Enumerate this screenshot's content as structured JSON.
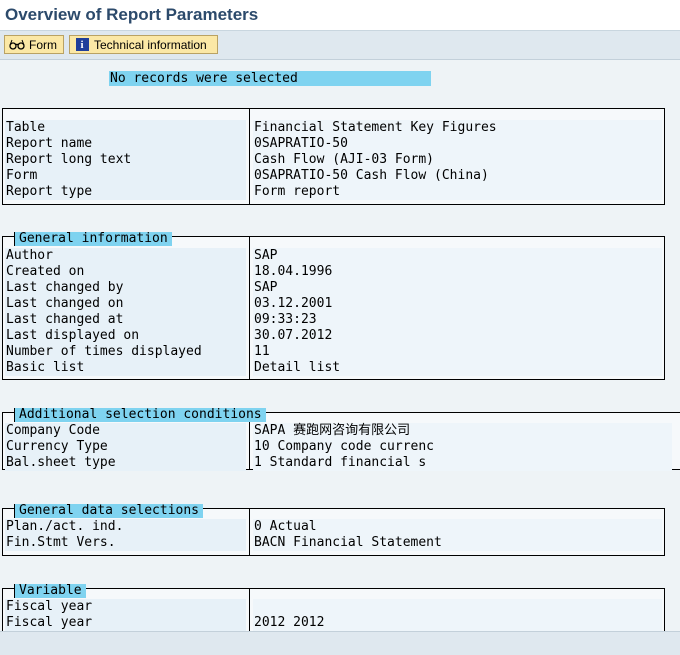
{
  "header": {
    "title": "Overview of Report Parameters"
  },
  "toolbar": {
    "form_label": "Form",
    "tech_label": "Technical information"
  },
  "message": "No records were selected",
  "section1": {
    "rows": [
      {
        "label": "Table",
        "value": "Financial Statement Key Figures"
      },
      {
        "label": "Report name",
        "value": "0SAPRATIO-50"
      },
      {
        "label": "Report long text",
        "value": "Cash Flow (AJI-03 Form)"
      },
      {
        "label": "Form",
        "value": "0SAPRATIO-50 Cash Flow  (China)"
      },
      {
        "label": "Report type",
        "value": "Form report"
      }
    ]
  },
  "general_info": {
    "title": "General information",
    "rows": [
      {
        "label": "Author",
        "value": "SAP"
      },
      {
        "label": "Created on",
        "value": "18.04.1996"
      },
      {
        "label": "Last changed by",
        "value": "SAP"
      },
      {
        "label": "Last changed on",
        "value": "03.12.2001"
      },
      {
        "label": "Last changed at",
        "value": "09:33:23"
      },
      {
        "label": "Last displayed on",
        "value": "30.07.2012"
      },
      {
        "label": "Number of times displayed",
        "value": "11"
      },
      {
        "label": "Basic list",
        "value": "Detail list"
      }
    ]
  },
  "additional": {
    "title": "Additional selection conditions",
    "rows": [
      {
        "label": "Company Code",
        "value": "SAPA 赛跑网咨询有限公司"
      },
      {
        "label": "Currency Type",
        "value": "10 Company code currenc"
      },
      {
        "label": "Bal.sheet type",
        "value": "1 Standard financial s"
      }
    ]
  },
  "general_data": {
    "title": "General data selections",
    "rows": [
      {
        "label": "Plan./act. ind.",
        "value": "0    Actual"
      },
      {
        "label": "Fin.Stmt Vers.",
        "value": "BACN Financial Statement"
      }
    ]
  },
  "variable": {
    "title": "Variable",
    "rows": [
      {
        "label": "Fiscal year",
        "value": ""
      },
      {
        "label": "Fiscal year",
        "value": "2012 2012"
      }
    ]
  }
}
